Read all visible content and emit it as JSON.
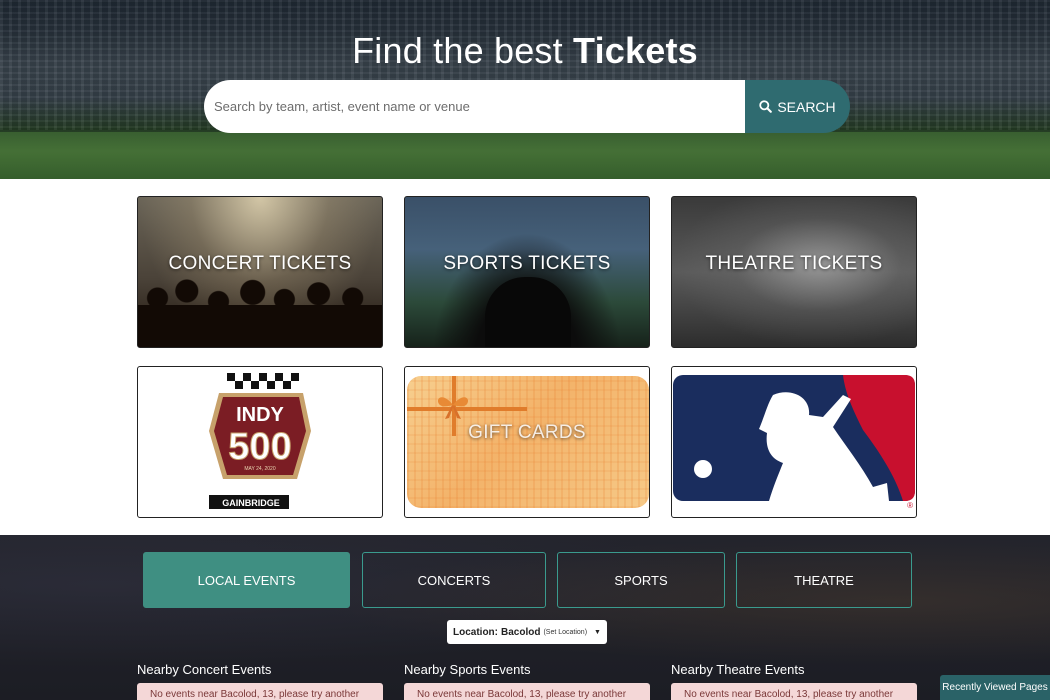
{
  "hero": {
    "title_prefix": "Find the best",
    "title_bold": "Tickets",
    "search_placeholder": "Search by team, artist, event name or venue",
    "search_button_label": "SEARCH"
  },
  "categories": [
    {
      "label": "CONCERT TICKETS"
    },
    {
      "label": "SPORTS TICKETS"
    },
    {
      "label": "THEATRE TICKETS"
    }
  ],
  "featured": {
    "indy": {
      "top": "INDY",
      "number": "500",
      "date": "MAY 24, 2020",
      "sponsor": "GAINBRIDGE"
    },
    "gift_label": "GIFT CARDS",
    "mlb_mark": "®"
  },
  "tabs": [
    {
      "label": "LOCAL EVENTS",
      "active": true
    },
    {
      "label": "CONCERTS",
      "active": false
    },
    {
      "label": "SPORTS",
      "active": false
    },
    {
      "label": "THEATRE",
      "active": false
    }
  ],
  "location": {
    "prefix": "Location:",
    "city": "Bacolod",
    "link": "(Set Location)"
  },
  "columns": [
    {
      "heading": "Nearby Concert Events",
      "notice": "No events near Bacolod, 13, please try another"
    },
    {
      "heading": "Nearby Sports Events",
      "notice": "No events near Bacolod, 13, please try another"
    },
    {
      "heading": "Nearby Theatre Events",
      "notice": "No events near Bacolod, 13, please try another"
    }
  ],
  "recently_viewed_label": "Recently Viewed Pages",
  "colors": {
    "accent": "#3f8f82",
    "search_button": "#2f6b70",
    "notice_bg": "#f4d7d7"
  }
}
